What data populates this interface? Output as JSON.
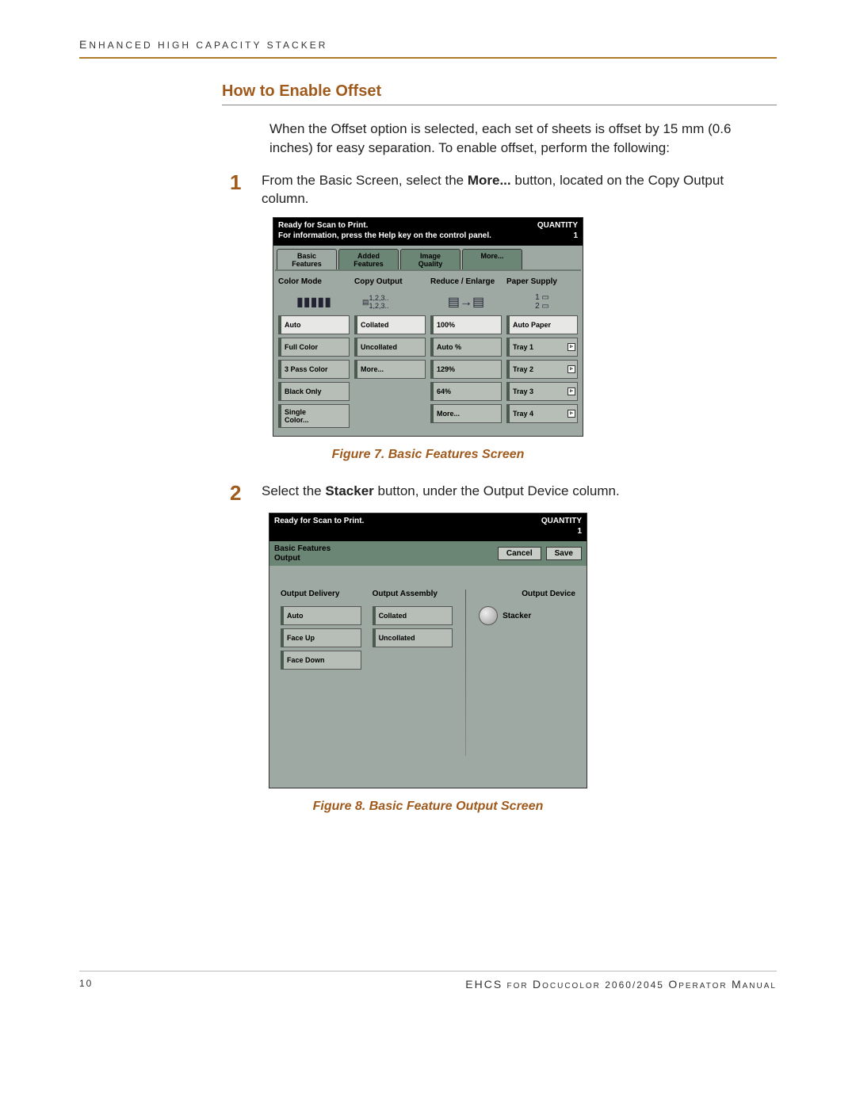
{
  "header": {
    "title": "ENHANCED HIGH CAPACITY STACKER"
  },
  "section_title": "How to Enable Offset",
  "intro": "When the Offset option is selected, each set of sheets is offset by 15 mm (0.6 inches) for easy separation. To enable offset, perform the following:",
  "step1": {
    "num": "1",
    "pre": "From the Basic Screen, select the ",
    "bold": "More...",
    "post": " button, located on the Copy Output column."
  },
  "step2": {
    "num": "2",
    "pre": "Select the ",
    "bold": "Stacker",
    "post": " button, under the Output Device column."
  },
  "figure1": "Figure 7. Basic Features Screen",
  "figure2": "Figure 8. Basic Feature Output Screen",
  "screen1": {
    "status_line1": "Ready for Scan to Print.",
    "status_line2": "For information, press the Help key on the control panel.",
    "quantity_label": "QUANTITY",
    "quantity_value": "1",
    "tabs": [
      "Basic\nFeatures",
      "Added\nFeatures",
      "Image\nQuality",
      "More..."
    ],
    "color_mode": {
      "title": "Color Mode",
      "options": [
        "Auto",
        "Full Color",
        "3 Pass Color",
        "Black Only",
        "Single\nColor..."
      ]
    },
    "copy_output": {
      "title": "Copy Output",
      "icon_text": "1,2,3..\n1,2,3..",
      "options": [
        "Collated",
        "Uncollated",
        "More..."
      ]
    },
    "reduce_enlarge": {
      "title": "Reduce / Enlarge",
      "options": [
        "100%",
        "Auto %",
        "129%",
        "64%",
        "More..."
      ]
    },
    "paper_supply": {
      "title": "Paper Supply",
      "options": [
        "Auto Paper",
        "Tray 1",
        "Tray 2",
        "Tray 3",
        "Tray 4"
      ]
    }
  },
  "screen2": {
    "status_line1": "Ready for Scan to Print.",
    "quantity_label": "QUANTITY",
    "quantity_value": "1",
    "title_line1": "Basic Features",
    "title_line2": "Output",
    "cancel": "Cancel",
    "save": "Save",
    "output_delivery": {
      "title": "Output Delivery",
      "options": [
        "Auto",
        "Face Up",
        "Face Down"
      ]
    },
    "output_assembly": {
      "title": "Output Assembly",
      "options": [
        "Collated",
        "Uncollated"
      ]
    },
    "output_device": {
      "title": "Output Device",
      "option": "Stacker"
    }
  },
  "footer": {
    "page": "10",
    "title": "EHCS FOR DOCUCOLOR 2060/2045 OPERATOR MANUAL"
  }
}
